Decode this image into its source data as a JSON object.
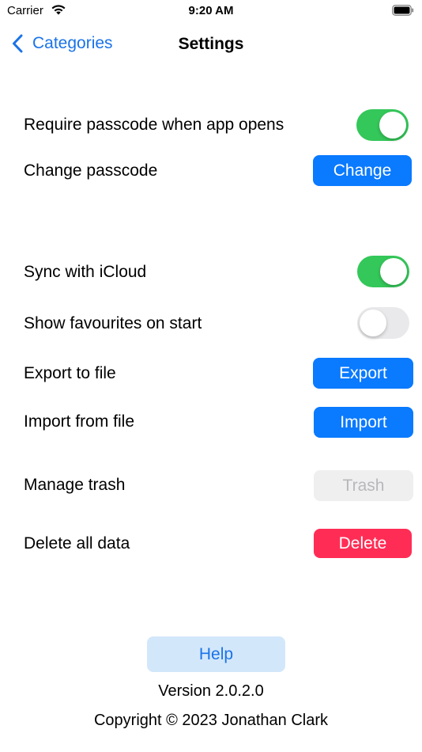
{
  "status_bar": {
    "carrier": "Carrier",
    "time": "9:20 AM",
    "wifi_icon": "wifi-icon",
    "battery_icon": "battery-full-icon"
  },
  "nav": {
    "back_label": "Categories",
    "back_icon": "chevron-left-icon",
    "title": "Settings"
  },
  "settings": {
    "require_passcode": {
      "label": "Require passcode when app opens",
      "enabled": true
    },
    "change_passcode": {
      "label": "Change passcode",
      "button": "Change"
    },
    "sync_icloud": {
      "label": "Sync with iCloud",
      "enabled": true
    },
    "show_favourites": {
      "label": "Show favourites on start",
      "enabled": false
    },
    "export": {
      "label": "Export to file",
      "button": "Export"
    },
    "import": {
      "label": "Import from file",
      "button": "Import"
    },
    "trash": {
      "label": "Manage trash",
      "button": "Trash",
      "disabled": true
    },
    "delete": {
      "label": "Delete all data",
      "button": "Delete"
    }
  },
  "footer": {
    "help_button": "Help",
    "version": "Version 2.0.2.0",
    "copyright": "Copyright © 2023 Jonathan Clark"
  },
  "colors": {
    "accent": "#0a7aff",
    "toggle_on": "#34c759",
    "danger": "#ff2d55",
    "help_bg": "#d3e7fb"
  }
}
